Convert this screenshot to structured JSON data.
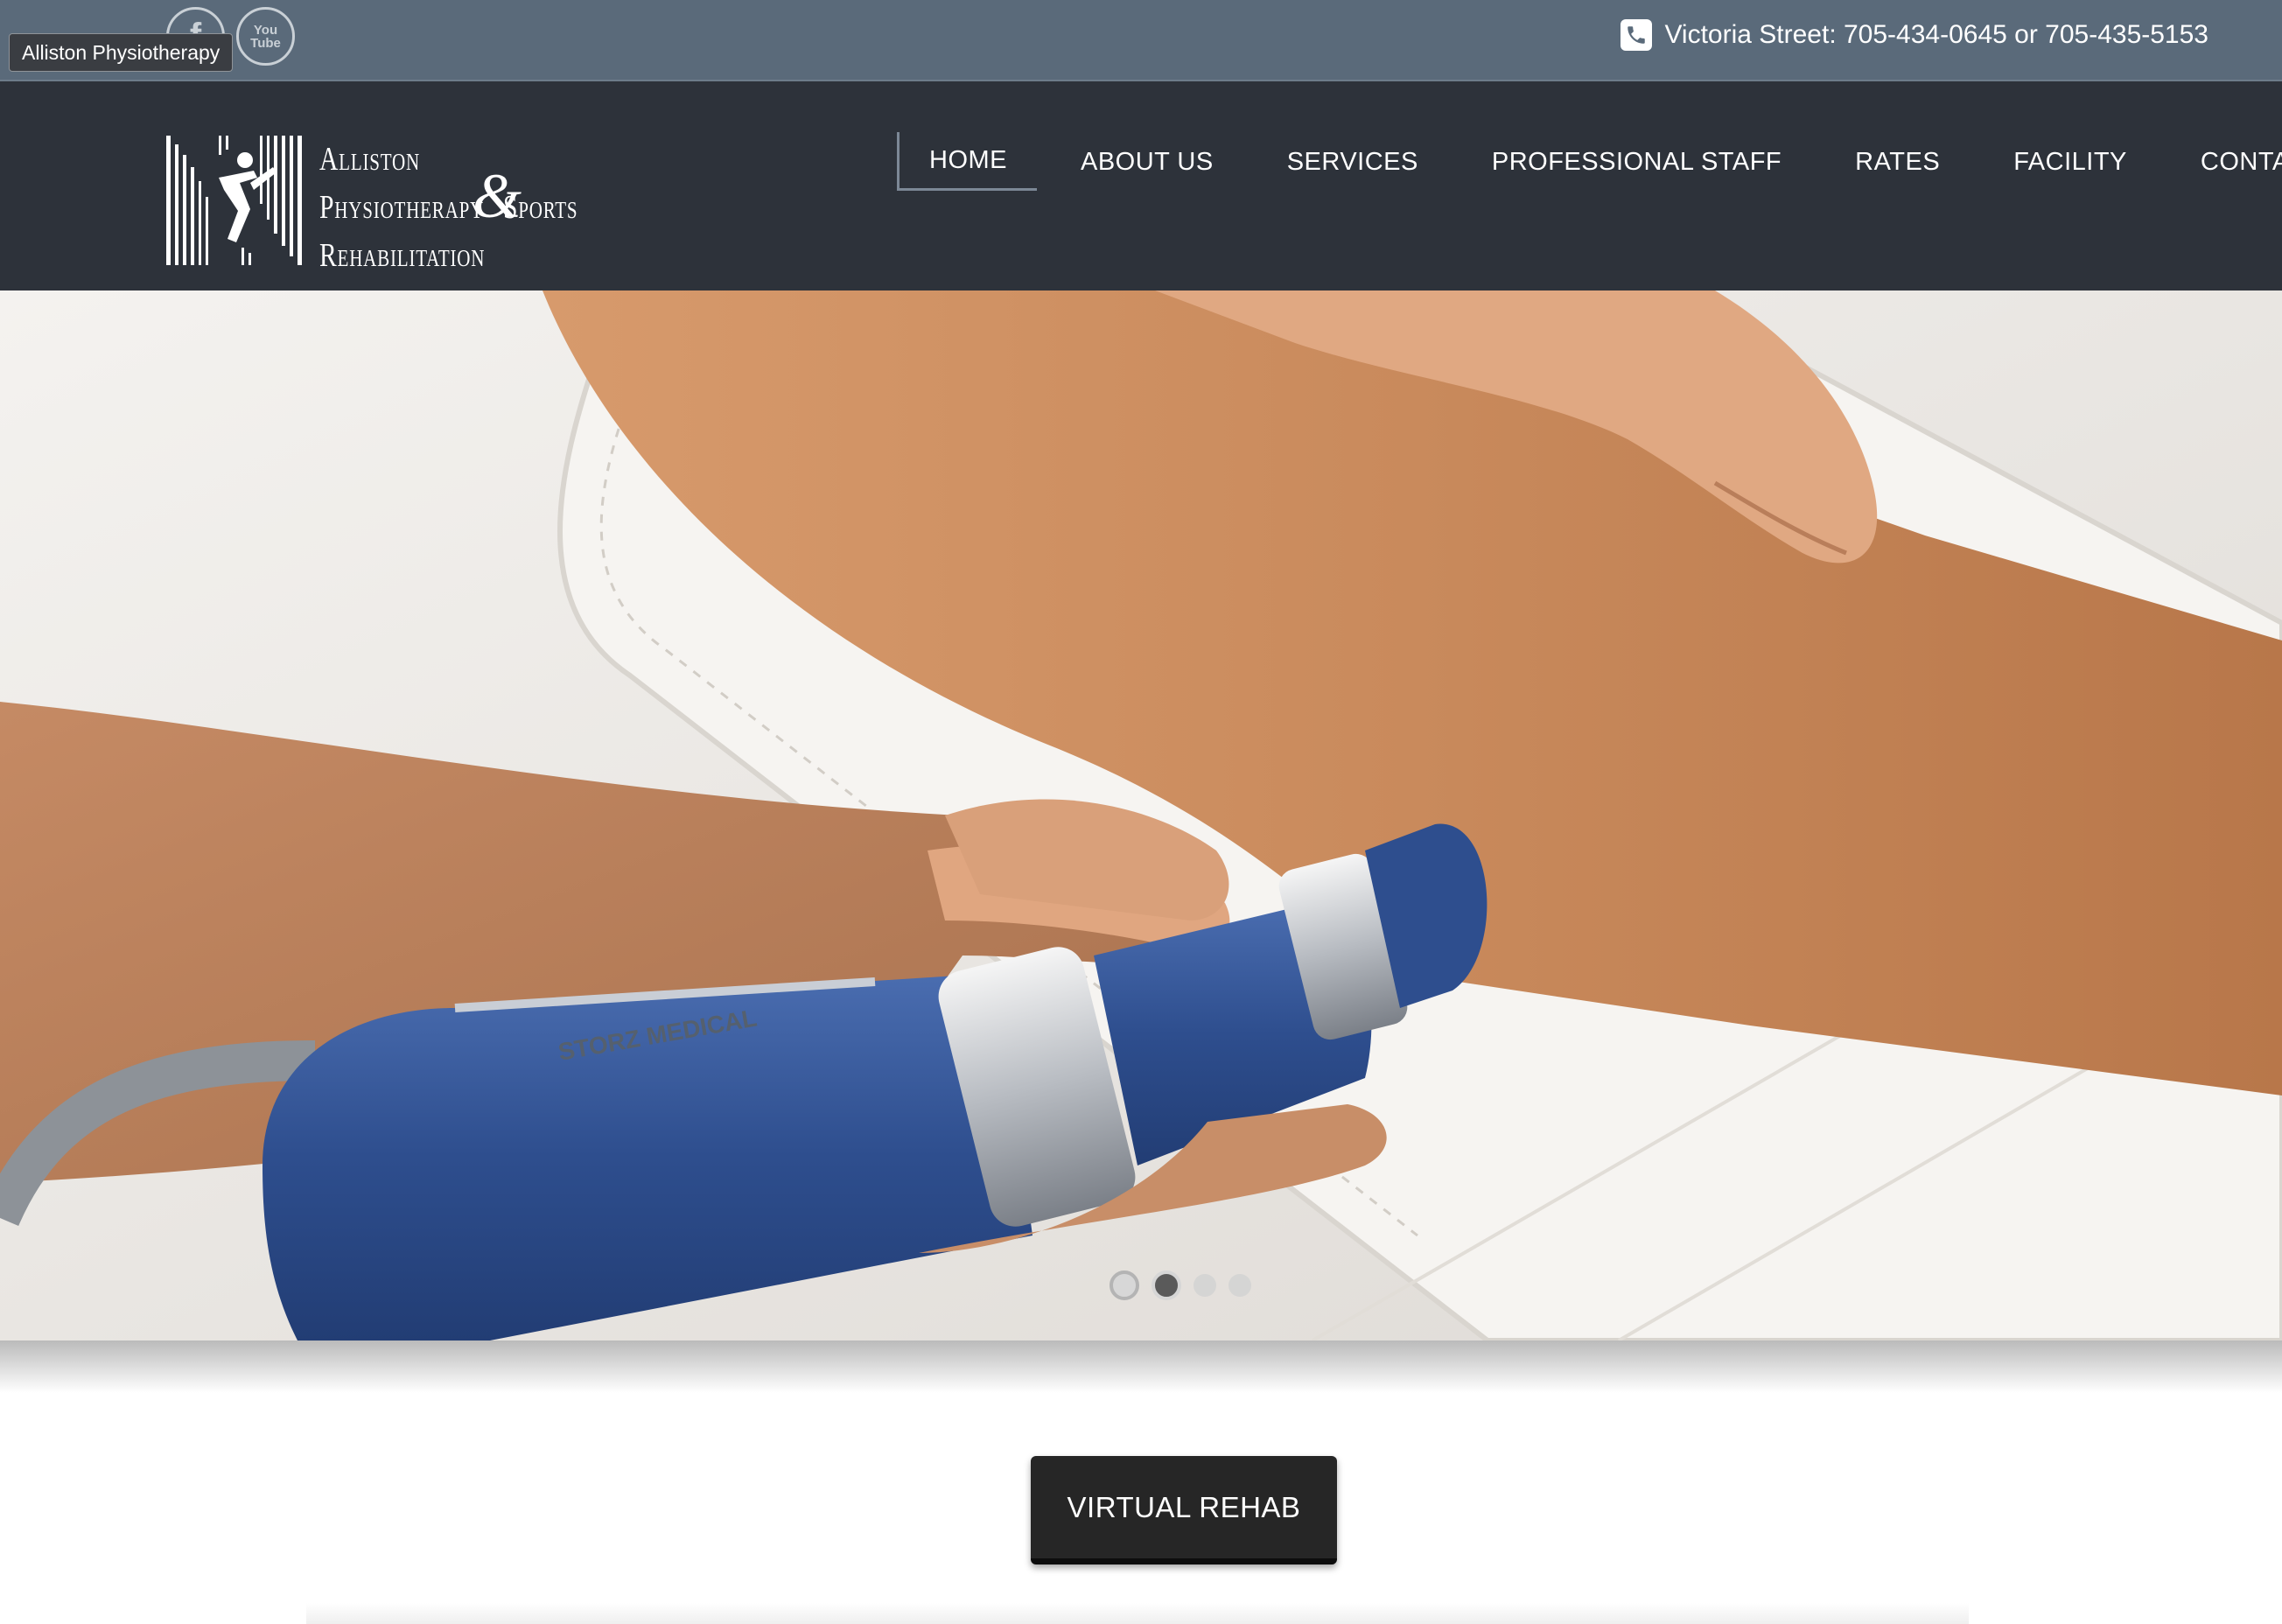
{
  "topbar": {
    "tooltip": "Alliston Physiotherapy",
    "social": [
      {
        "icon": "facebook-icon",
        "glyph": "f"
      },
      {
        "icon": "youtube-icon",
        "glyph": "You Tube"
      }
    ],
    "phone_text": "Victoria Street: 705-434-0645 or 705-435-5153"
  },
  "logo": {
    "line1": "Alliston",
    "line2": "Physiotherapy",
    "amp": "&",
    "line2b": "Sports",
    "line3": "Rehabilitation"
  },
  "nav": {
    "items": [
      {
        "label": "HOME",
        "active": true
      },
      {
        "label": "ABOUT US"
      },
      {
        "label": "SERVICES"
      },
      {
        "label": "PROFESSIONAL STAFF"
      },
      {
        "label": "RATES"
      },
      {
        "label": "FACILITY"
      },
      {
        "label": "CONTACT"
      }
    ]
  },
  "hero": {
    "device_text": "STORZ MEDICAL",
    "slides_total": 4,
    "active_slide": 2
  },
  "cta": {
    "label": "VIRTUAL REHAB"
  },
  "colors": {
    "topbar": "#5a6a7a",
    "header": "#2d323a",
    "device_blue": "#2e4e8e",
    "button": "#262626"
  }
}
